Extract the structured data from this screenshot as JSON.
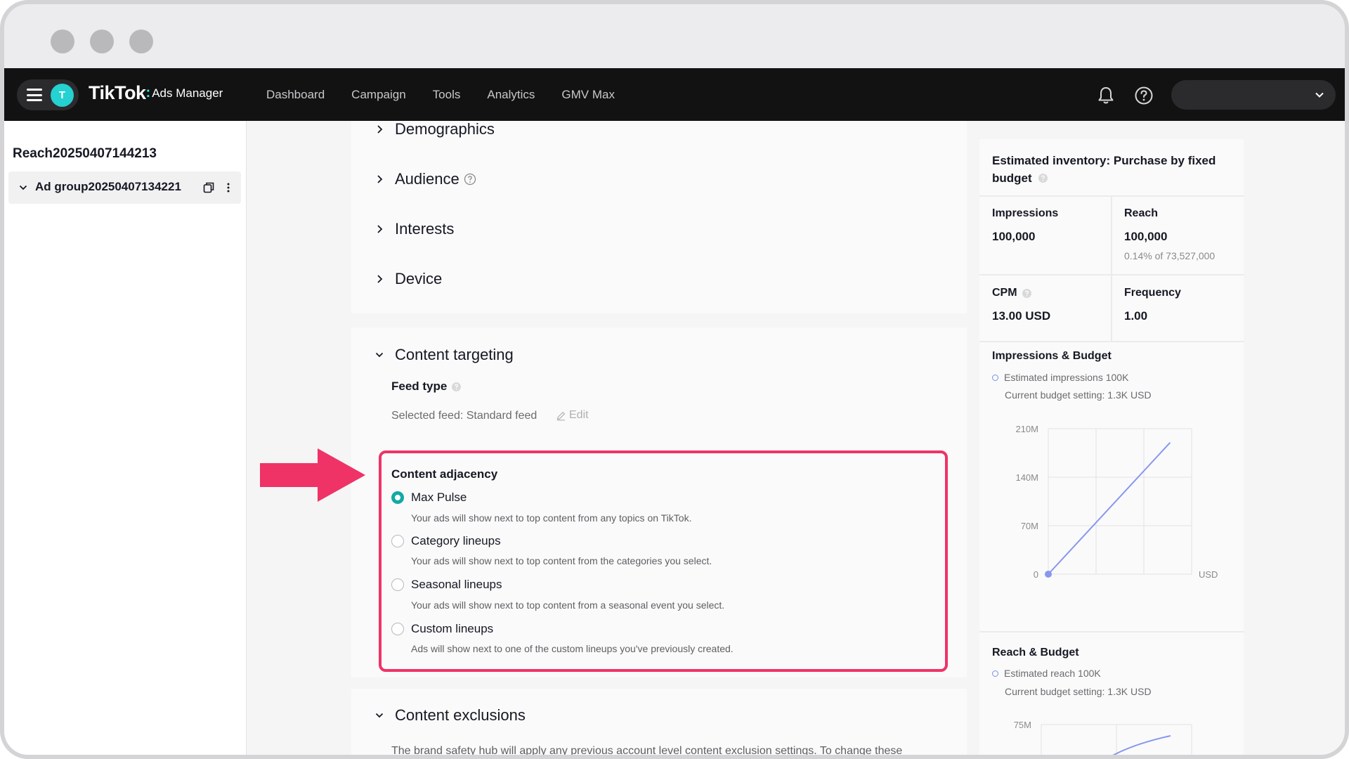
{
  "nav": {
    "avatar_letter": "T",
    "brand_name": "TikTok",
    "brand_colon": ":",
    "brand_sub": "Ads Manager",
    "links": [
      "Dashboard",
      "Campaign",
      "Tools",
      "Analytics",
      "GMV Max"
    ]
  },
  "sidebar": {
    "campaign_name": "Reach20250407144213",
    "ad_group_name": "Ad group20250407134221"
  },
  "targeting": {
    "sections": [
      "Demographics",
      "Audience",
      "Interests",
      "Device"
    ]
  },
  "content_targeting": {
    "title": "Content targeting",
    "feed_type_label": "Feed type",
    "selected_feed": "Selected feed: Standard feed",
    "edit_label": "Edit",
    "adjacency_title": "Content adjacency",
    "options": [
      {
        "label": "Max Pulse",
        "desc": "Your ads will show next to top content from any topics on TikTok.",
        "selected": true
      },
      {
        "label": "Category lineups",
        "desc": "Your ads will show next to top content from the categories you select.",
        "selected": false
      },
      {
        "label": "Seasonal lineups",
        "desc": "Your ads will show next to top content from a seasonal event you select.",
        "selected": false
      },
      {
        "label": "Custom lineups",
        "desc": "Ads will show next to one of the custom lineups you've previously created.",
        "selected": false
      }
    ]
  },
  "content_exclusions": {
    "title": "Content exclusions",
    "desc": "The brand safety hub will apply any previous account level content exclusion settings. To change these"
  },
  "estimate": {
    "title": "Estimated inventory: Purchase by fixed budget",
    "impressions_label": "Impressions",
    "impressions_value": "100,000",
    "reach_label": "Reach",
    "reach_value": "100,000",
    "reach_sub": "0.14% of 73,527,000",
    "cpm_label": "CPM",
    "cpm_value": "13.00 USD",
    "frequency_label": "Frequency",
    "frequency_value": "1.00",
    "imp_budget_title": "Impressions & Budget",
    "imp_legend": "Estimated impressions 100K",
    "imp_budget_setting": "Current budget setting: 1.3K USD",
    "reach_budget_title": "Reach & Budget",
    "reach_legend": "Estimated reach 100K",
    "reach_budget_setting": "Current budget setting: 1.3K USD"
  },
  "colors": {
    "accent_teal": "#12a9a6",
    "highlight_red": "#ef3366",
    "chart_line": "#8797ee",
    "nav_bg": "#121212"
  },
  "chart_data": [
    {
      "type": "line",
      "title": "Impressions & Budget",
      "x": [
        0,
        3
      ],
      "x_unit": "USD",
      "xticks": [
        "0",
        "1M",
        "2M",
        "3M"
      ],
      "yticks": [
        "0",
        "70M",
        "140M",
        "210M"
      ],
      "xlim": [
        0,
        3
      ],
      "ylim": [
        0,
        210
      ],
      "series": [
        {
          "values": [
            0,
            190
          ]
        }
      ],
      "grid": true
    },
    {
      "type": "line",
      "title": "Reach & Budget",
      "yticks": [
        "75M"
      ],
      "series": [
        {
          "values": []
        }
      ],
      "grid": true
    }
  ]
}
